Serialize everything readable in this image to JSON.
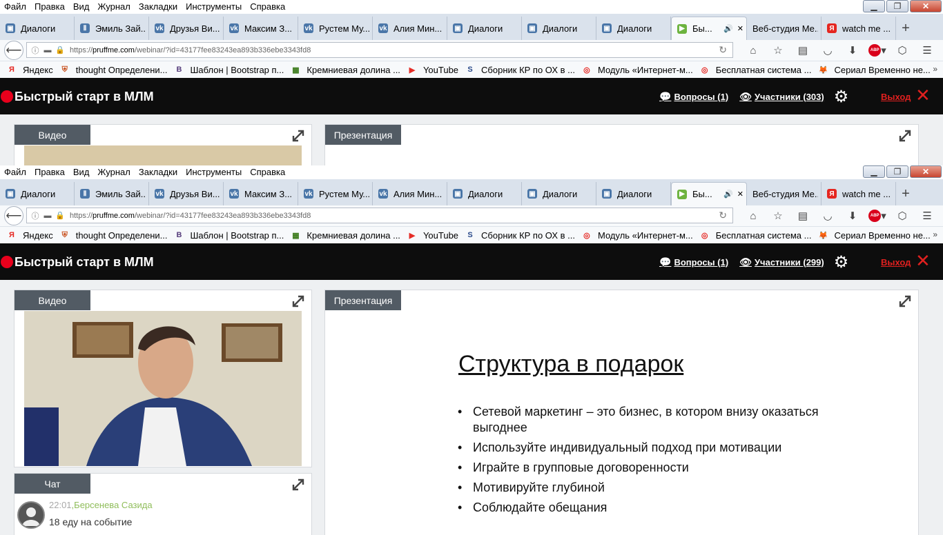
{
  "menu": [
    "Файл",
    "Правка",
    "Вид",
    "Журнал",
    "Закладки",
    "Инструменты",
    "Справка"
  ],
  "window_controls": [
    "minimize",
    "maximize",
    "close"
  ],
  "tabs": [
    {
      "label": "Диалоги",
      "icon": "vk-messages-icon",
      "color": "#4a76a8",
      "active": false
    },
    {
      "label": "Эмиль Зай...",
      "icon": "pause-icon",
      "color": "#4a76a8",
      "active": false
    },
    {
      "label": "Друзья Ви...",
      "icon": "vk-icon",
      "color": "#4a76a8",
      "active": false
    },
    {
      "label": "Максим З...",
      "icon": "vk-icon",
      "color": "#4a76a8",
      "active": false
    },
    {
      "label": "Рустем Му...",
      "icon": "vk-icon",
      "color": "#4a76a8",
      "active": false
    },
    {
      "label": "Алия Мин...",
      "icon": "vk-icon",
      "color": "#4a76a8",
      "active": false
    },
    {
      "label": "Диалоги",
      "icon": "vk-messages-icon",
      "color": "#4a76a8",
      "active": false
    },
    {
      "label": "Диалоги",
      "icon": "vk-messages-icon",
      "color": "#4a76a8",
      "active": false
    },
    {
      "label": "Диалоги",
      "icon": "vk-messages-icon",
      "color": "#4a76a8",
      "active": false
    },
    {
      "label": "Бы...",
      "icon": "webinar-icon",
      "color": "#6db33f",
      "active": true
    },
    {
      "label": "Веб-студия Ме...",
      "icon": "",
      "color": "",
      "active": false
    },
    {
      "label": "watch me ...",
      "icon": "yandex-icon",
      "color": "#e52620",
      "active": false
    }
  ],
  "new_tab": "+",
  "address": {
    "prefix": "https://",
    "domain": "pruffme.com",
    "path": "/webinar/?id=43177fee83243ea893b336ebe3343fd8"
  },
  "bookmarks": [
    {
      "label": "Яндекс",
      "icon": "yandex-icon",
      "color": "#e52620"
    },
    {
      "label": "thought Определени...",
      "icon": "cambridge-icon",
      "color": "#c8501e"
    },
    {
      "label": "Шаблон | Bootstrap п...",
      "icon": "bootstrap-icon",
      "color": "#563d7c"
    },
    {
      "label": "Кремниевая долина ...",
      "icon": "tv-icon",
      "color": "#3a7a1a"
    },
    {
      "label": "YouTube",
      "icon": "youtube-icon",
      "color": "#e52d27"
    },
    {
      "label": "Сборник КР по ОХ в ...",
      "icon": "s-icon",
      "color": "#2a4a8a"
    },
    {
      "label": "Модуль «Интернет-м...",
      "icon": "circle-a-icon",
      "color": "#e52620"
    },
    {
      "label": "Бесплатная система ...",
      "icon": "circle-a-icon",
      "color": "#e52620"
    },
    {
      "label": "Сериал Временно не...",
      "icon": "fox-icon",
      "color": "#e87a1a"
    }
  ],
  "bookmarks_more": "»",
  "app": {
    "title": "Быстрый старт в МЛМ",
    "questions": "Вопросы (1)",
    "participants_back": "Участники (303)",
    "participants_front": "Участники (299)",
    "exit": "Выход",
    "accent": "#e8001c"
  },
  "panels": {
    "video": "Видео",
    "presentation": "Презентация",
    "chat": "Чат"
  },
  "slide": {
    "title": "Структура в подарок",
    "bullets": [
      "Сетевой маркетинг – это бизнес, в котором внизу оказаться выгоднее",
      "Используйте индивидуальный подход при мотивации",
      "Играйте в групповые договоренности",
      "Мотивируйте глубиной",
      "Соблюдайте обещания"
    ]
  },
  "chat": {
    "time": "22:01",
    "author": "Берсенева Сазида",
    "message": "18 еду на событие"
  }
}
